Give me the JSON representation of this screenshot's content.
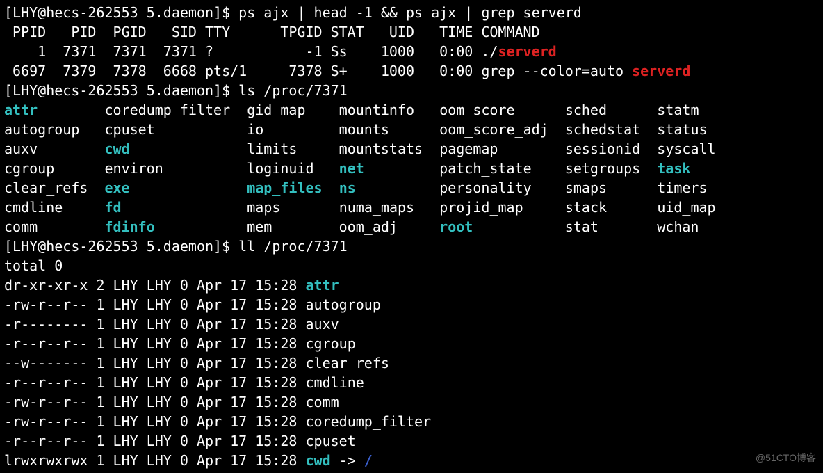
{
  "prompt1_user": "LHY@hecs-262553",
  "prompt1_dir": "5.daemon",
  "cmd1": "ps ajx | head -1 && ps ajx | grep serverd",
  "ps_header": " PPID   PID  PGID   SID TTY      TPGID STAT   UID   TIME COMMAND",
  "ps_row1": "    1  7371  7371  7371 ?           -1 Ss    1000   0:00 ",
  "ps_row1_cmd_prefix": "./",
  "ps_row1_cmd_name": "serverd",
  "ps_row2": " 6697  7379  7378  6668 pts/1     7378 S+    1000   0:00 grep --color=auto ",
  "ps_row2_match": "serverd",
  "prompt2_user": "LHY@hecs-262553",
  "prompt2_dir": "5.daemon",
  "cmd2": "ls /proc/7371",
  "ls_cols": [
    [
      "attr",
      "coredump_filter",
      "gid_map",
      "mountinfo",
      "oom_score",
      "sched",
      "statm"
    ],
    [
      "autogroup",
      "cpuset",
      "io",
      "mounts",
      "oom_score_adj",
      "schedstat",
      "status"
    ],
    [
      "auxv",
      "cwd",
      "limits",
      "mountstats",
      "pagemap",
      "sessionid",
      "syscall"
    ],
    [
      "cgroup",
      "environ",
      "loginuid",
      "net",
      "patch_state",
      "setgroups",
      "task"
    ],
    [
      "clear_refs",
      "exe",
      "map_files",
      "ns",
      "personality",
      "smaps",
      "timers"
    ],
    [
      "cmdline",
      "fd",
      "maps",
      "numa_maps",
      "projid_map",
      "stack",
      "uid_map"
    ],
    [
      "comm",
      "fdinfo",
      "mem",
      "oom_adj",
      "root",
      "stat",
      "wchan"
    ]
  ],
  "ls_col_widths": [
    12,
    17,
    11,
    12,
    15,
    11,
    9
  ],
  "ls_highlight": [
    "attr",
    "cwd",
    "exe",
    "fd",
    "fdinfo",
    "map_files",
    "net",
    "ns",
    "root",
    "task"
  ],
  "prompt3_user": "LHY@hecs-262553",
  "prompt3_dir": "5.daemon",
  "cmd3": "ll /proc/7371",
  "ll_total": "total 0",
  "ll_rows": [
    {
      "perms": "dr-xr-xr-x",
      "nl": "2",
      "u": "LHY",
      "g": "LHY",
      "sz": "0",
      "date": "Apr 17 15:28",
      "name": "attr",
      "cls": "cyan"
    },
    {
      "perms": "-rw-r--r--",
      "nl": "1",
      "u": "LHY",
      "g": "LHY",
      "sz": "0",
      "date": "Apr 17 15:28",
      "name": "autogroup",
      "cls": ""
    },
    {
      "perms": "-r--------",
      "nl": "1",
      "u": "LHY",
      "g": "LHY",
      "sz": "0",
      "date": "Apr 17 15:28",
      "name": "auxv",
      "cls": ""
    },
    {
      "perms": "-r--r--r--",
      "nl": "1",
      "u": "LHY",
      "g": "LHY",
      "sz": "0",
      "date": "Apr 17 15:28",
      "name": "cgroup",
      "cls": ""
    },
    {
      "perms": "--w-------",
      "nl": "1",
      "u": "LHY",
      "g": "LHY",
      "sz": "0",
      "date": "Apr 17 15:28",
      "name": "clear_refs",
      "cls": ""
    },
    {
      "perms": "-r--r--r--",
      "nl": "1",
      "u": "LHY",
      "g": "LHY",
      "sz": "0",
      "date": "Apr 17 15:28",
      "name": "cmdline",
      "cls": ""
    },
    {
      "perms": "-rw-r--r--",
      "nl": "1",
      "u": "LHY",
      "g": "LHY",
      "sz": "0",
      "date": "Apr 17 15:28",
      "name": "comm",
      "cls": ""
    },
    {
      "perms": "-rw-r--r--",
      "nl": "1",
      "u": "LHY",
      "g": "LHY",
      "sz": "0",
      "date": "Apr 17 15:28",
      "name": "coredump_filter",
      "cls": ""
    },
    {
      "perms": "-r--r--r--",
      "nl": "1",
      "u": "LHY",
      "g": "LHY",
      "sz": "0",
      "date": "Apr 17 15:28",
      "name": "cpuset",
      "cls": ""
    },
    {
      "perms": "lrwxrwxrwx",
      "nl": "1",
      "u": "LHY",
      "g": "LHY",
      "sz": "0",
      "date": "Apr 17 15:28",
      "name": "cwd",
      "cls": "cyan",
      "arrow": " -> ",
      "target": "/",
      "tcls": "blue"
    }
  ],
  "watermark": "@51CTO博客"
}
